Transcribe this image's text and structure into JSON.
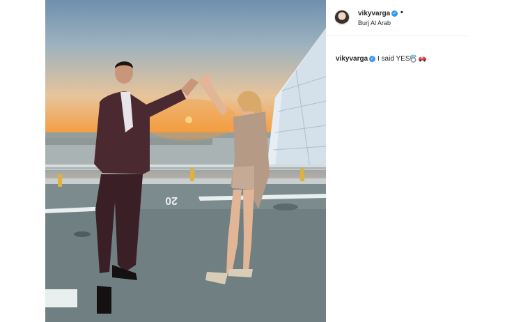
{
  "post": {
    "author": "vikyvarga",
    "verified": true,
    "location": "Burj Al Arab",
    "separator": "•",
    "caption": {
      "username": "vikyvarga",
      "text": "I said YES!",
      "emojis": [
        "ring-icon",
        "red-car-icon"
      ]
    },
    "verified_glyph": "✓",
    "image": {
      "helipad_marking": "20"
    }
  },
  "colors": {
    "verified": "#3897f0",
    "text": "#262626",
    "divider": "#efefef"
  }
}
